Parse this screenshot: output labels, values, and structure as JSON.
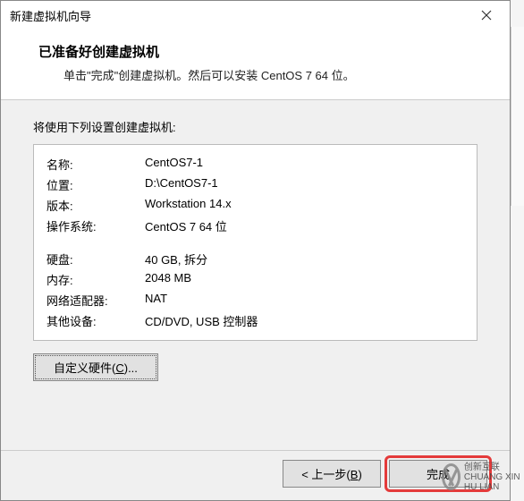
{
  "titlebar": {
    "title": "新建虚拟机向导"
  },
  "header": {
    "heading": "已准备好创建虚拟机",
    "subtext": "单击\"完成\"创建虚拟机。然后可以安装 CentOS 7 64 位。"
  },
  "body": {
    "intro": "将使用下列设置创建虚拟机:",
    "rows_a": [
      {
        "label": "名称:",
        "value": "CentOS7-1"
      },
      {
        "label": "位置:",
        "value": "D:\\CentOS7-1"
      },
      {
        "label": "版本:",
        "value": "Workstation 14.x"
      },
      {
        "label": "操作系统:",
        "value": "CentOS 7 64 位"
      }
    ],
    "rows_b": [
      {
        "label": "硬盘:",
        "value": "40 GB, 拆分"
      },
      {
        "label": "内存:",
        "value": "2048 MB"
      },
      {
        "label": "网络适配器:",
        "value": "NAT"
      },
      {
        "label": "其他设备:",
        "value": "CD/DVD, USB 控制器"
      }
    ],
    "customize_pre": "自定义硬件(",
    "customize_u": "C",
    "customize_post": ")..."
  },
  "footer": {
    "back_pre": "< 上一步(",
    "back_u": "B",
    "back_post": ")",
    "finish": "完成"
  },
  "watermark": {
    "brand": "创新互联",
    "sub": "CHUANG XIN HU LIAN"
  }
}
